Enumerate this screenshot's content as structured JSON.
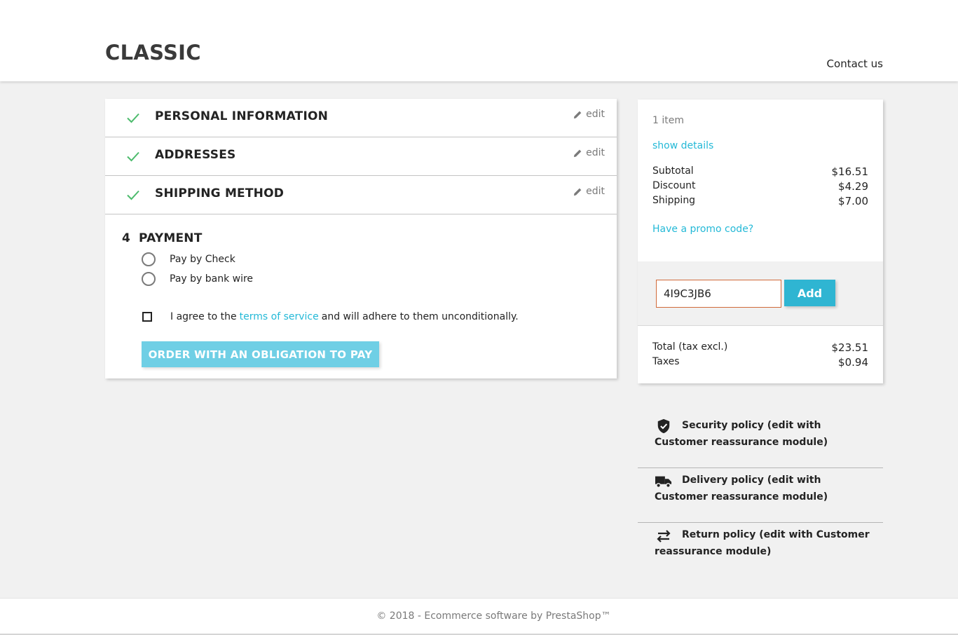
{
  "header": {
    "logo": "CLASSIC",
    "contact_label": "Contact us"
  },
  "steps": [
    {
      "title": "PERSONAL INFORMATION",
      "edit_label": "edit",
      "status": "complete"
    },
    {
      "title": "ADDRESSES",
      "edit_label": "edit",
      "status": "complete"
    },
    {
      "title": "SHIPPING METHOD",
      "edit_label": "edit",
      "status": "complete"
    }
  ],
  "payment": {
    "number": "4",
    "title": "PAYMENT",
    "options": [
      {
        "label": "Pay by Check",
        "selected": false
      },
      {
        "label": "Pay by bank wire",
        "selected": false
      }
    ],
    "tos_prefix": "I agree to the",
    "tos_link": "terms of service",
    "tos_suffix": "and will adhere to them unconditionally.",
    "tos_checked": false,
    "order_button": "ORDER WITH AN OBLIGATION TO PAY"
  },
  "summary": {
    "items_count": "1 item",
    "show_details": "show details",
    "lines": [
      {
        "label": "Subtotal",
        "value": "$16.51"
      },
      {
        "label": "Discount",
        "value": "$4.29"
      },
      {
        "label": "Shipping",
        "value": "$7.00"
      }
    ],
    "promo_link": "Have a promo code?",
    "promo_input_value": "4I9C3JB6",
    "promo_add_label": "Add",
    "totals": [
      {
        "label": "Total (tax excl.)",
        "value": "$23.51"
      },
      {
        "label": "Taxes",
        "value": "$0.94"
      }
    ]
  },
  "reassurance": [
    {
      "icon": "shield-check-icon",
      "text": "Security policy (edit with Customer reassurance module)"
    },
    {
      "icon": "truck-icon",
      "text": "Delivery policy (edit with Customer reassurance module)"
    },
    {
      "icon": "swap-arrows-icon",
      "text": "Return policy (edit with Customer reassurance module)"
    }
  ],
  "footer": {
    "text": "© 2018 - Ecommerce software by PrestaShop™"
  },
  "colors": {
    "accent": "#24b9d7",
    "check_green": "#4cbb6c",
    "order_button_bg": "#6fcfe5",
    "promo_input_border": "#d06a3a"
  }
}
